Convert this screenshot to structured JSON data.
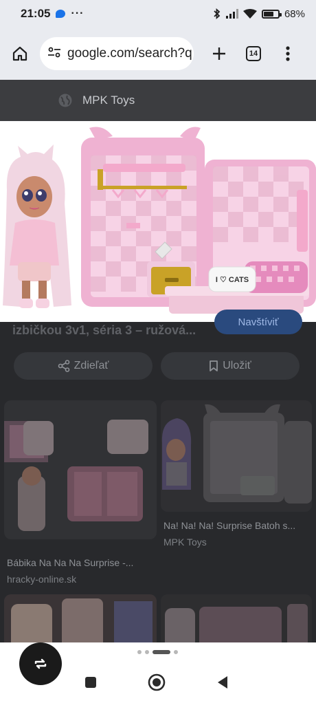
{
  "status_bar": {
    "time": "21:05",
    "more": "···",
    "battery_percent": "68%",
    "battery_level": 0.68
  },
  "browser": {
    "url": "google.com/search?q",
    "tab_count": "14"
  },
  "page": {
    "source": "MPK Toys",
    "title": "izbičkou 3v1, séria 3 – ružová...",
    "visit_label": "Navštíviť",
    "share_label": "Zdieľať",
    "save_label": "Uložiť",
    "results": [
      {
        "title": "Bábika Na Na Na Surprise -...",
        "source": "hracky-online.sk"
      },
      {
        "title": "Na! Na! Na! Surprise Batoh s...",
        "source": "MPK Toys"
      }
    ],
    "hero_image_text": "I ♡ CATS"
  },
  "colors": {
    "pink_light": "#f7d3e6",
    "pink": "#efb2d2",
    "pink_deep": "#e58bbd",
    "gold": "#c9a227"
  }
}
